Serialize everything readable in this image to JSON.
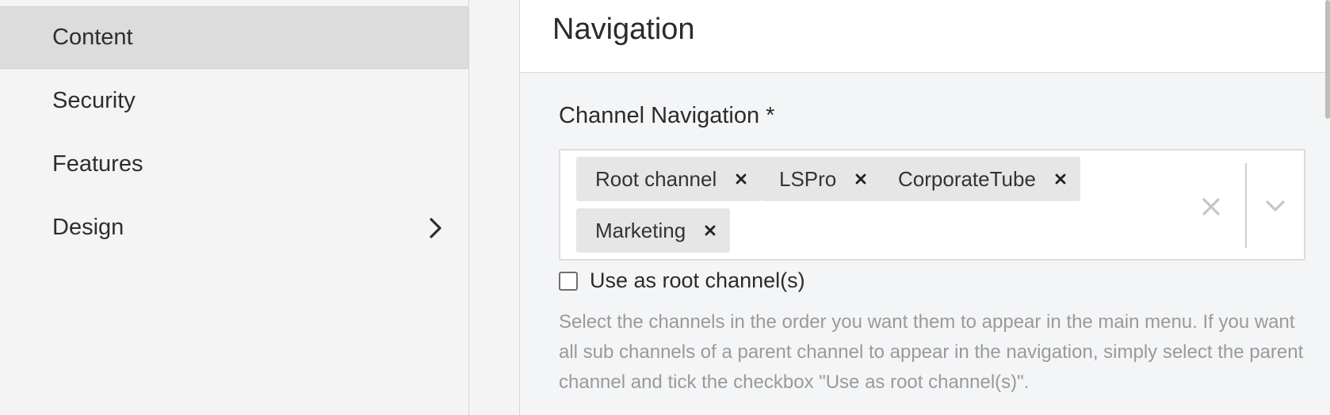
{
  "sidebar": {
    "items": [
      {
        "label": "Content",
        "active": true
      },
      {
        "label": "Security",
        "active": false
      },
      {
        "label": "Features",
        "active": false
      },
      {
        "label": "Design",
        "active": false,
        "has_submenu": true,
        "icon": "chevron-right-icon"
      }
    ]
  },
  "main": {
    "title": "Navigation",
    "channel_navigation": {
      "label": "Channel Navigation *",
      "selected": [
        {
          "label": "Root channel",
          "remove_icon": "close-icon"
        },
        {
          "label": "LSPro",
          "remove_icon": "close-icon"
        },
        {
          "label": "CorporateTube",
          "remove_icon": "close-icon"
        },
        {
          "label": "Marketing",
          "remove_icon": "close-icon"
        }
      ],
      "clear_icon": "close-icon",
      "toggle_icon": "chevron-down-icon"
    },
    "use_as_root": {
      "label": "Use as root channel(s)",
      "checked": false
    },
    "help_text": "Select the channels in the order you want them to appear in the main menu. If you want all sub channels of a parent channel to appear in the navigation, simply select the parent channel and tick the checkbox \"Use as root channel(s)\"."
  },
  "colors": {
    "sidebar_bg": "#f4f4f4",
    "sidebar_active_bg": "#dcdcdc",
    "chip_bg": "#e6e6e6",
    "help_text": "#9a9a9a"
  }
}
